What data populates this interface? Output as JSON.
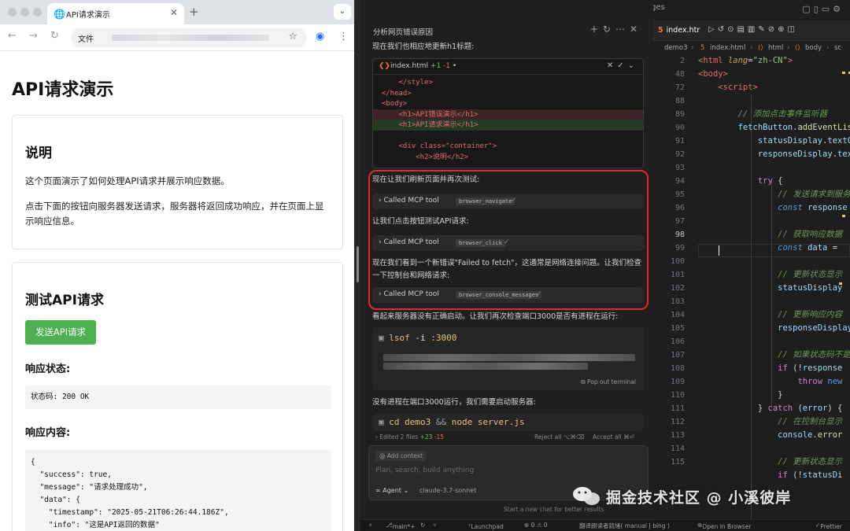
{
  "browser": {
    "tab_title": "API请求演示",
    "address_label": "文件",
    "page": {
      "heading": "API请求演示",
      "intro": {
        "title": "说明",
        "p1": "这个页面演示了如何处理API请求并展示响应数据。",
        "p2": "点击下面的按钮向服务器发送请求，服务器将返回成功响应，并在页面上显示响应信息。"
      },
      "test": {
        "title": "测试API请求",
        "button": "发送API请求",
        "status_heading": "响应状态:",
        "status_value": "状态码: 200 OK",
        "content_heading": "响应内容:",
        "response_lines": [
          "{",
          "  \"success\": true,",
          "  \"message\": \"请求处理成功\",",
          "  \"data\": {",
          "    \"timestamp\": \"2025-05-21T06:26:44.186Z\",",
          "    \"info\": \"这是API返回的数据\""
        ]
      }
    }
  },
  "window": {
    "search_title": "cursor-edgegone-pages"
  },
  "chat": {
    "header": "分析网页错误原因",
    "msg1": "现在我们也相应地更新h1标题:",
    "diff": {
      "file": "index.html",
      "added": "+1",
      "removed": "-1",
      "lines": [
        {
          "t": "      </style>",
          "k": ""
        },
        {
          "t": "  </head>",
          "k": ""
        },
        {
          "t": "  <body>",
          "k": ""
        },
        {
          "t": "      <h1>API错误演示</h1>",
          "k": "del"
        },
        {
          "t": "      <h1>API请求演示</h1>",
          "k": "add"
        },
        {
          "t": "",
          "k": ""
        },
        {
          "t": "      <div class=\"container\">",
          "k": ""
        },
        {
          "t": "          <h2>说明</h2>",
          "k": ""
        }
      ]
    },
    "msg2": "现在让我们刷新页面并再次测试:",
    "tool1": {
      "label": "Called MCP tool",
      "tag": "browser_navigate"
    },
    "msg3": "让我们点击按钮测试API请求:",
    "tool2": {
      "label": "Called MCP tool",
      "tag": "browser_click"
    },
    "msg4": "现在我们看到一个新错误\"Failed to fetch\"，这通常是网络连接问题。让我们检查一下控制台和网络请求:",
    "tool3": {
      "label": "Called MCP tool",
      "tag": "browser_console_messages"
    },
    "msg5": "看起来服务器没有正确启动。让我们再次检查端口3000是否有进程在运行:",
    "term1": {
      "cmd": "lsof",
      "flag": "-i",
      "arg": ":3000",
      "pop": "Pop out terminal"
    },
    "msg6": "没有进程在端口3000运行，我们需要启动服务器:",
    "term2": {
      "cmd": "cd demo3",
      "op": "&&",
      "cmd2": "node server.js"
    },
    "edited": {
      "label": "Edited 2 files",
      "added": "+23",
      "removed": "-15",
      "reject": "Reject all ⌥⌘⌫",
      "accept": "Accept all ⌘⏎"
    },
    "composer": {
      "context": "Add context",
      "placeholder": "Plan, search, build anything",
      "agent": "Agent",
      "model": "claude-3.7-sonnet"
    },
    "hint": "Start a new chat for better results"
  },
  "editor": {
    "tab": "index.htr",
    "breadcrumb": [
      "demo3",
      "index.html",
      "html",
      "body",
      "sc"
    ],
    "current_line": 98,
    "line_numbers": [
      2,
      48,
      72,
      88,
      89,
      90,
      91,
      92,
      93,
      94,
      95,
      96,
      97,
      98,
      99,
      100,
      101,
      102,
      103,
      104,
      105,
      106,
      107,
      108,
      109,
      110,
      111,
      112,
      113,
      114,
      115
    ]
  },
  "status": {
    "branch": "main*+",
    "problems": "⊗ 0 ⚠ 0",
    "launchpad": "Launchpad",
    "translate": "翻译朗读者就绪( manual | bing )",
    "open_browser": "Open In Browser",
    "prettier": "Prettier"
  },
  "watermark": "掘金技术社区 @ 小溪彼岸"
}
